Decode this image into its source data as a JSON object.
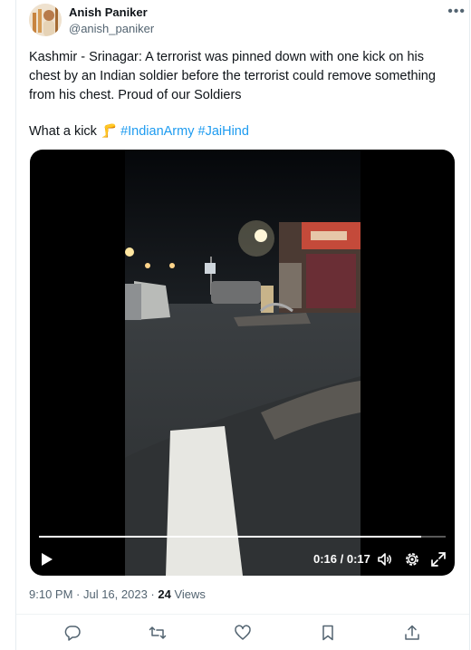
{
  "author": {
    "display_name": "Anish Paniker",
    "handle": "@anish_paniker"
  },
  "tweet": {
    "text_main": "Kashmir - Srinagar: A terrorist was pinned down with one kick on his chest by an Indian soldier before the terrorist could remove something from his chest. Proud of our Soldiers",
    "text_second_prefix": "What a kick ",
    "emoji": "🦵",
    "hashtags": [
      "#IndianArmy",
      "#JaiHind"
    ]
  },
  "video": {
    "time_display": "0:16 / 0:17",
    "progress": 0.94
  },
  "meta": {
    "time": "9:10 PM · Jul 16, 2023 · ",
    "views_count": "24",
    "views_label": " Views"
  },
  "colors": {
    "accent": "#1d9bf0",
    "muted": "#536471",
    "text": "#0f1419"
  },
  "icons": [
    "more-icon",
    "play-icon",
    "volume-icon",
    "settings-icon",
    "fullscreen-icon",
    "reply-icon",
    "retweet-icon",
    "like-icon",
    "bookmark-icon",
    "share-icon"
  ]
}
